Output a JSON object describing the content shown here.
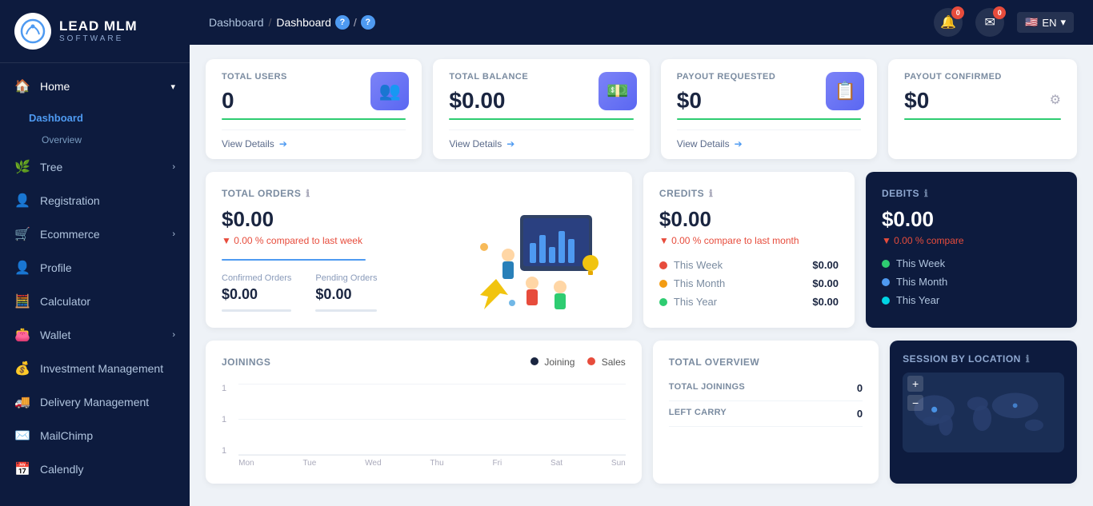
{
  "logo": {
    "title": "LEAD MLM",
    "subtitle": "SOFTWARE"
  },
  "sidebar": {
    "items": [
      {
        "id": "home",
        "label": "Home",
        "icon": "🏠",
        "hasArrow": true,
        "active": true
      },
      {
        "id": "dashboard",
        "label": "Dashboard",
        "isSubItem": true,
        "active": true
      },
      {
        "id": "overview",
        "label": "Overview",
        "isSubLabel": true
      },
      {
        "id": "tree",
        "label": "Tree",
        "icon": "🌿",
        "hasArrow": true
      },
      {
        "id": "registration",
        "label": "Registration",
        "icon": "👤",
        "hasArrow": false
      },
      {
        "id": "ecommerce",
        "label": "Ecommerce",
        "icon": "🛒",
        "hasArrow": true
      },
      {
        "id": "profile",
        "label": "Profile",
        "icon": "👤",
        "hasArrow": false
      },
      {
        "id": "calculator",
        "label": "Calculator",
        "icon": "🧮",
        "hasArrow": false
      },
      {
        "id": "wallet",
        "label": "Wallet",
        "icon": "👛",
        "hasArrow": true
      },
      {
        "id": "investment",
        "label": "Investment Management",
        "icon": "💰",
        "hasArrow": false
      },
      {
        "id": "delivery",
        "label": "Delivery Management",
        "icon": "🚚",
        "hasArrow": false
      },
      {
        "id": "mailchimp",
        "label": "MailChimp",
        "icon": "✉️",
        "hasArrow": false
      },
      {
        "id": "calendly",
        "label": "Calendly",
        "icon": "📅",
        "hasArrow": false
      }
    ]
  },
  "topbar": {
    "breadcrumb": [
      "Dashboard",
      "Dashboard"
    ],
    "notifications_count": "0",
    "messages_count": "0",
    "lang": "EN"
  },
  "stat_cards": [
    {
      "id": "total-users",
      "label": "TOTAL USERS",
      "value": "0",
      "footer": "View Details",
      "icon": "👥",
      "icon_bg": "#6c77f5"
    },
    {
      "id": "total-balance",
      "label": "TOTAL BALANCE",
      "value": "$0.00",
      "footer": "View Details",
      "icon": "💵",
      "icon_bg": "#6c77f5"
    },
    {
      "id": "payout-requested",
      "label": "PAYOUT REQUESTED",
      "value": "$0",
      "footer": "View Details",
      "icon": "📋",
      "icon_bg": "#6c77f5"
    },
    {
      "id": "payout-confirmed",
      "label": "PAYOUT CONFIRMED",
      "value": "$0",
      "footer": null,
      "icon": null
    }
  ],
  "orders": {
    "label": "TOTAL ORDERS",
    "value": "$0.00",
    "pct": "▼ 0.00 % compared to last week",
    "confirmed_label": "Confirmed Orders",
    "confirmed_value": "$0.00",
    "pending_label": "Pending Orders",
    "pending_value": "$0.00"
  },
  "credits": {
    "label": "CREDITS",
    "value": "$0.00",
    "pct": "▼ 0.00 % compare to last month",
    "periods": [
      {
        "label": "This Week",
        "value": "$0.00",
        "color": "#e74c3c"
      },
      {
        "label": "This Month",
        "value": "$0.00",
        "color": "#f39c12"
      },
      {
        "label": "This Year",
        "value": "$0.00",
        "color": "#2ecc71"
      }
    ]
  },
  "debits": {
    "label": "DEBITS",
    "value": "$0.00",
    "pct": "▼ 0.00 % compare",
    "periods": [
      {
        "label": "This Week",
        "value": "",
        "color": "#2ecc71"
      },
      {
        "label": "This Month",
        "value": "",
        "color": "#4e9af1"
      },
      {
        "label": "This Year",
        "value": "",
        "color": "#00d4e4"
      }
    ]
  },
  "joinings": {
    "label": "JOININGS",
    "legend": [
      {
        "label": "Joining",
        "color": "#1a2540"
      },
      {
        "label": "Sales",
        "color": "#e74c3c"
      }
    ],
    "y_labels": [
      "1",
      "1",
      "1"
    ]
  },
  "session": {
    "label": "SESSION BY LOCATION"
  },
  "overview": {
    "label": "TOTAL OVERVIEW",
    "rows": [
      {
        "label": "TOTAL JOININGS",
        "value": "0"
      },
      {
        "label": "LEFT CARRY",
        "value": "0"
      }
    ]
  }
}
